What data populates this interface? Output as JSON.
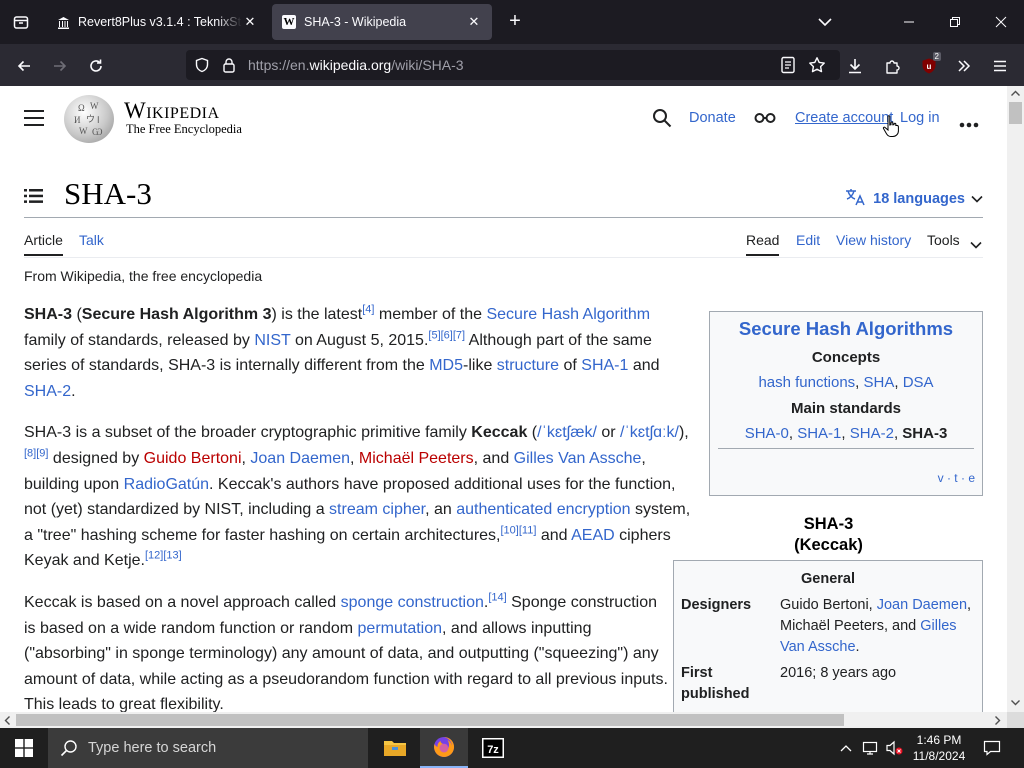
{
  "browser": {
    "tabs": [
      {
        "title": "Revert8Plus v3.1.4 : TeknixStuff",
        "active": false
      },
      {
        "title": "SHA-3 - Wikipedia",
        "active": true
      }
    ],
    "url": {
      "prefix": "https://en.",
      "domain": "wikipedia.org",
      "path": "/wiki/SHA-3"
    },
    "extension_badge": "2"
  },
  "wiki_header": {
    "logo_word": "Wikipedia",
    "logo_tagline": "The Free Encyclopedia",
    "donate": "Donate",
    "create_account": "Create account",
    "log_in": "Log in"
  },
  "article": {
    "title": "SHA-3",
    "languages": "18 languages",
    "tabs_left": [
      "Article",
      "Talk"
    ],
    "tabs_right": [
      "Read",
      "Edit",
      "View history",
      "Tools"
    ],
    "from": "From Wikipedia, the free encyclopedia"
  },
  "navbox": {
    "title": "Secure Hash Algorithms",
    "concepts_heading": "Concepts",
    "concepts": [
      "hash functions",
      "SHA",
      "DSA"
    ],
    "main_heading": "Main standards",
    "main": [
      "SHA-0",
      "SHA-1",
      "SHA-2",
      "SHA-3"
    ],
    "vte": [
      "v",
      "t",
      "e"
    ]
  },
  "infobox": {
    "caption_line1": "SHA-3",
    "caption_line2": "(Keccak)",
    "section": "General",
    "designers_label": "Designers",
    "first_published_label1": "First",
    "first_published_label2": "published",
    "first_published_value": "2016; 8 years ago"
  },
  "taskbar": {
    "search_placeholder": "Type here to search",
    "time": "1:46 PM",
    "date": "11/8/2024"
  },
  "colors": {
    "link": "#3366cc",
    "redlink": "#ba0000",
    "chrome_bg": "#1c1b22",
    "toolbar_bg": "#2b2a33"
  }
}
